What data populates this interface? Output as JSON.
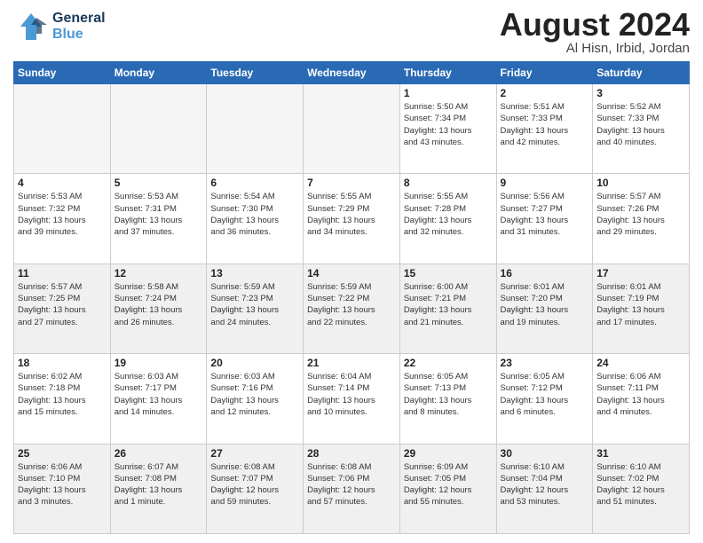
{
  "header": {
    "logo_general": "General",
    "logo_blue": "Blue",
    "month_title": "August 2024",
    "location": "Al Hisn, Irbid, Jordan"
  },
  "days_of_week": [
    "Sunday",
    "Monday",
    "Tuesday",
    "Wednesday",
    "Thursday",
    "Friday",
    "Saturday"
  ],
  "weeks": [
    [
      {
        "day": "",
        "info": "",
        "empty": true
      },
      {
        "day": "",
        "info": "",
        "empty": true
      },
      {
        "day": "",
        "info": "",
        "empty": true
      },
      {
        "day": "",
        "info": "",
        "empty": true
      },
      {
        "day": "1",
        "info": "Sunrise: 5:50 AM\nSunset: 7:34 PM\nDaylight: 13 hours\nand 43 minutes.",
        "empty": false
      },
      {
        "day": "2",
        "info": "Sunrise: 5:51 AM\nSunset: 7:33 PM\nDaylight: 13 hours\nand 42 minutes.",
        "empty": false
      },
      {
        "day": "3",
        "info": "Sunrise: 5:52 AM\nSunset: 7:33 PM\nDaylight: 13 hours\nand 40 minutes.",
        "empty": false
      }
    ],
    [
      {
        "day": "4",
        "info": "Sunrise: 5:53 AM\nSunset: 7:32 PM\nDaylight: 13 hours\nand 39 minutes.",
        "empty": false
      },
      {
        "day": "5",
        "info": "Sunrise: 5:53 AM\nSunset: 7:31 PM\nDaylight: 13 hours\nand 37 minutes.",
        "empty": false
      },
      {
        "day": "6",
        "info": "Sunrise: 5:54 AM\nSunset: 7:30 PM\nDaylight: 13 hours\nand 36 minutes.",
        "empty": false
      },
      {
        "day": "7",
        "info": "Sunrise: 5:55 AM\nSunset: 7:29 PM\nDaylight: 13 hours\nand 34 minutes.",
        "empty": false
      },
      {
        "day": "8",
        "info": "Sunrise: 5:55 AM\nSunset: 7:28 PM\nDaylight: 13 hours\nand 32 minutes.",
        "empty": false
      },
      {
        "day": "9",
        "info": "Sunrise: 5:56 AM\nSunset: 7:27 PM\nDaylight: 13 hours\nand 31 minutes.",
        "empty": false
      },
      {
        "day": "10",
        "info": "Sunrise: 5:57 AM\nSunset: 7:26 PM\nDaylight: 13 hours\nand 29 minutes.",
        "empty": false
      }
    ],
    [
      {
        "day": "11",
        "info": "Sunrise: 5:57 AM\nSunset: 7:25 PM\nDaylight: 13 hours\nand 27 minutes.",
        "empty": false
      },
      {
        "day": "12",
        "info": "Sunrise: 5:58 AM\nSunset: 7:24 PM\nDaylight: 13 hours\nand 26 minutes.",
        "empty": false
      },
      {
        "day": "13",
        "info": "Sunrise: 5:59 AM\nSunset: 7:23 PM\nDaylight: 13 hours\nand 24 minutes.",
        "empty": false
      },
      {
        "day": "14",
        "info": "Sunrise: 5:59 AM\nSunset: 7:22 PM\nDaylight: 13 hours\nand 22 minutes.",
        "empty": false
      },
      {
        "day": "15",
        "info": "Sunrise: 6:00 AM\nSunset: 7:21 PM\nDaylight: 13 hours\nand 21 minutes.",
        "empty": false
      },
      {
        "day": "16",
        "info": "Sunrise: 6:01 AM\nSunset: 7:20 PM\nDaylight: 13 hours\nand 19 minutes.",
        "empty": false
      },
      {
        "day": "17",
        "info": "Sunrise: 6:01 AM\nSunset: 7:19 PM\nDaylight: 13 hours\nand 17 minutes.",
        "empty": false
      }
    ],
    [
      {
        "day": "18",
        "info": "Sunrise: 6:02 AM\nSunset: 7:18 PM\nDaylight: 13 hours\nand 15 minutes.",
        "empty": false
      },
      {
        "day": "19",
        "info": "Sunrise: 6:03 AM\nSunset: 7:17 PM\nDaylight: 13 hours\nand 14 minutes.",
        "empty": false
      },
      {
        "day": "20",
        "info": "Sunrise: 6:03 AM\nSunset: 7:16 PM\nDaylight: 13 hours\nand 12 minutes.",
        "empty": false
      },
      {
        "day": "21",
        "info": "Sunrise: 6:04 AM\nSunset: 7:14 PM\nDaylight: 13 hours\nand 10 minutes.",
        "empty": false
      },
      {
        "day": "22",
        "info": "Sunrise: 6:05 AM\nSunset: 7:13 PM\nDaylight: 13 hours\nand 8 minutes.",
        "empty": false
      },
      {
        "day": "23",
        "info": "Sunrise: 6:05 AM\nSunset: 7:12 PM\nDaylight: 13 hours\nand 6 minutes.",
        "empty": false
      },
      {
        "day": "24",
        "info": "Sunrise: 6:06 AM\nSunset: 7:11 PM\nDaylight: 13 hours\nand 4 minutes.",
        "empty": false
      }
    ],
    [
      {
        "day": "25",
        "info": "Sunrise: 6:06 AM\nSunset: 7:10 PM\nDaylight: 13 hours\nand 3 minutes.",
        "empty": false
      },
      {
        "day": "26",
        "info": "Sunrise: 6:07 AM\nSunset: 7:08 PM\nDaylight: 13 hours\nand 1 minute.",
        "empty": false
      },
      {
        "day": "27",
        "info": "Sunrise: 6:08 AM\nSunset: 7:07 PM\nDaylight: 12 hours\nand 59 minutes.",
        "empty": false
      },
      {
        "day": "28",
        "info": "Sunrise: 6:08 AM\nSunset: 7:06 PM\nDaylight: 12 hours\nand 57 minutes.",
        "empty": false
      },
      {
        "day": "29",
        "info": "Sunrise: 6:09 AM\nSunset: 7:05 PM\nDaylight: 12 hours\nand 55 minutes.",
        "empty": false
      },
      {
        "day": "30",
        "info": "Sunrise: 6:10 AM\nSunset: 7:04 PM\nDaylight: 12 hours\nand 53 minutes.",
        "empty": false
      },
      {
        "day": "31",
        "info": "Sunrise: 6:10 AM\nSunset: 7:02 PM\nDaylight: 12 hours\nand 51 minutes.",
        "empty": false
      }
    ]
  ]
}
